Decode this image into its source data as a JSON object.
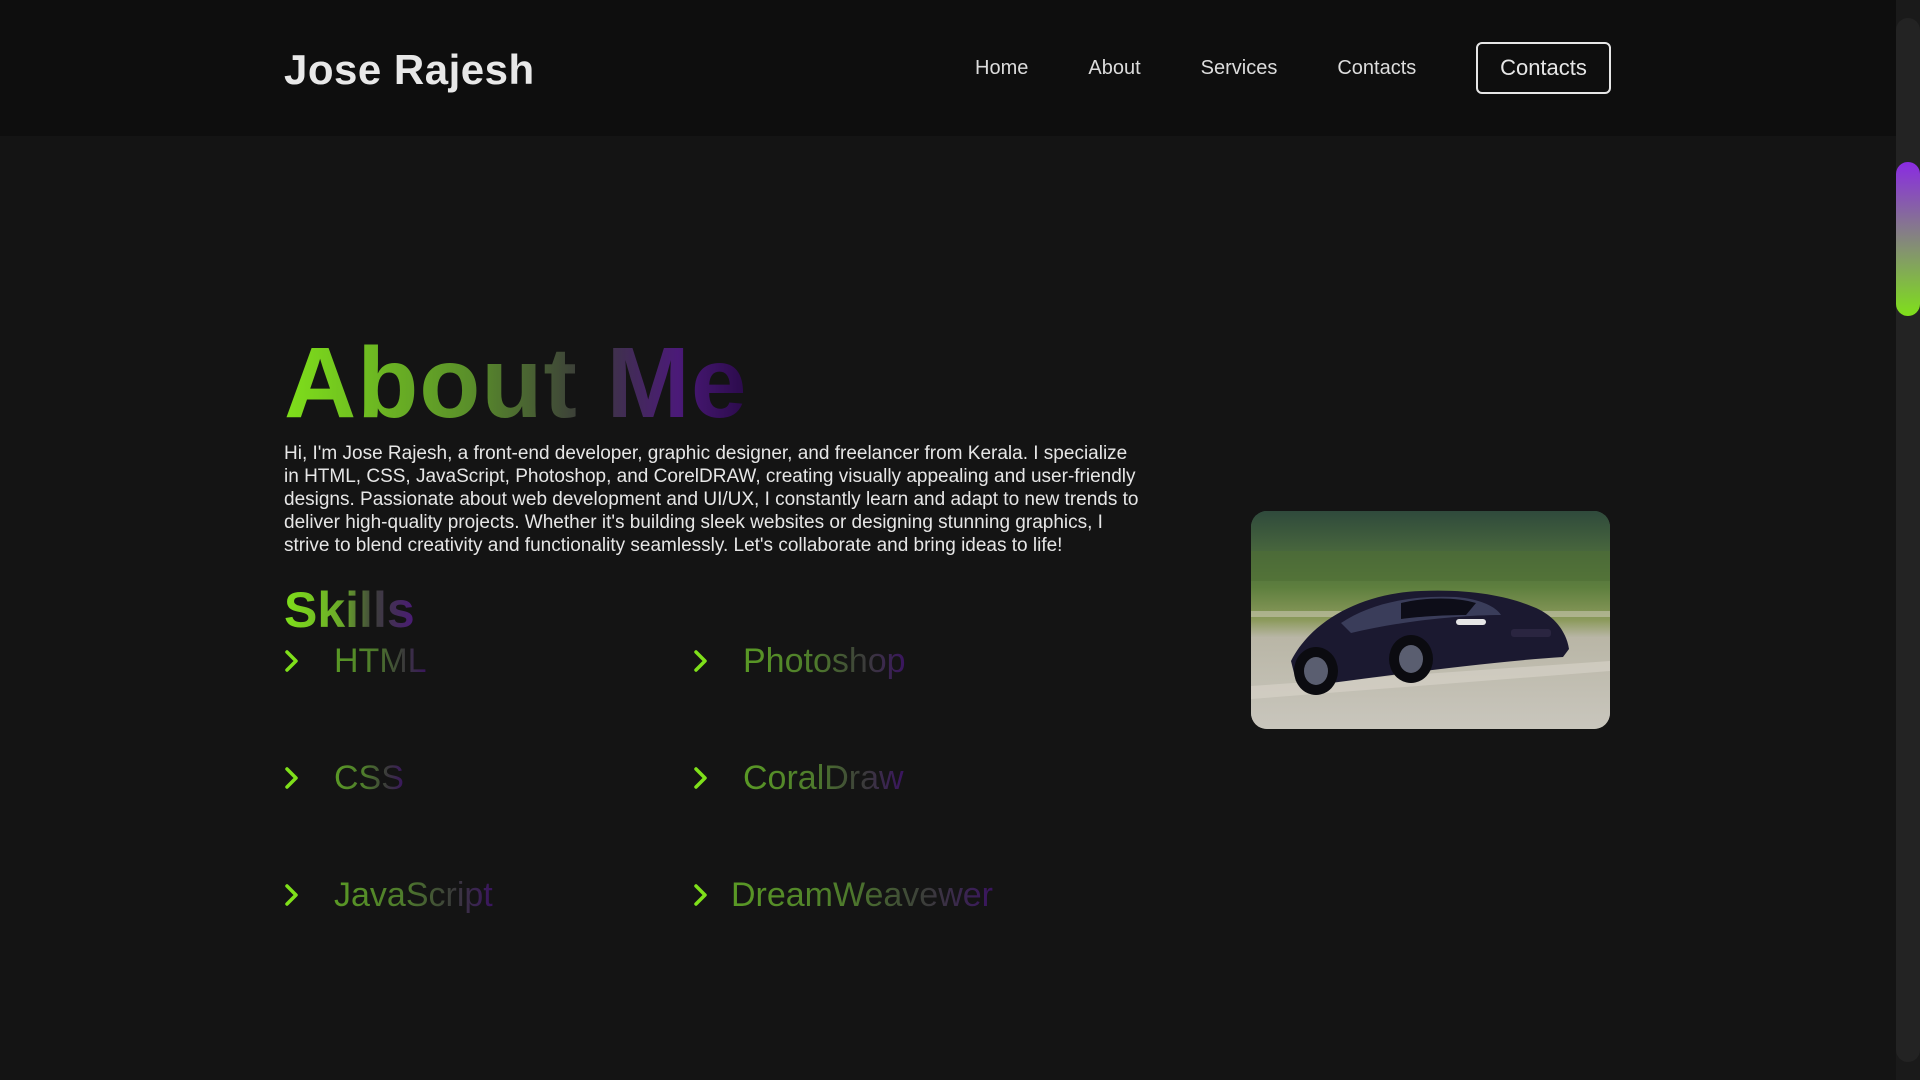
{
  "header": {
    "logo": "Jose Rajesh",
    "nav": [
      {
        "label": "Home"
      },
      {
        "label": "About"
      },
      {
        "label": "Services"
      },
      {
        "label": "Contacts"
      }
    ],
    "cta_label": "Contacts"
  },
  "about": {
    "title": "About Me",
    "text": "Hi, I'm Jose Rajesh, a front-end developer, graphic designer, and freelancer from Kerala. I specialize in HTML, CSS, JavaScript, Photoshop, and CorelDRAW, creating visually appealing and user-friendly designs. Passionate about web development and UI/UX, I constantly learn and adapt to new trends to deliver high-quality projects. Whether it's building sleek websites or designing stunning graphics, I strive to blend creativity and functionality seamlessly. Let's collaborate and bring ideas to life!"
  },
  "skills": {
    "title": "Skills",
    "items": [
      {
        "label": "HTML"
      },
      {
        "label": "Photoshop"
      },
      {
        "label": "CSS"
      },
      {
        "label": "CoralDraw"
      },
      {
        "label": "JavaScript"
      },
      {
        "label": "DreamWeavewer"
      }
    ]
  },
  "image": {
    "icon": "car-photo"
  },
  "colors": {
    "accent_green": "#7fe01a",
    "accent_purple": "#8a2be2",
    "background": "#141414",
    "header_bg": "#0e0e0e"
  }
}
